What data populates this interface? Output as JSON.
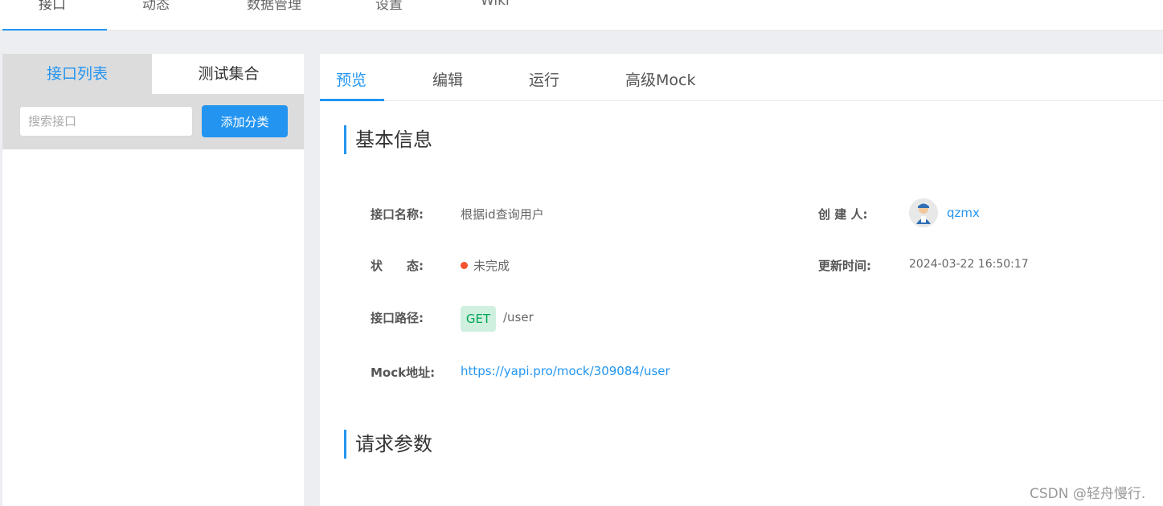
{
  "topnav": {
    "tabs": [
      "接口",
      "动态",
      "数据管理",
      "设置",
      "Wiki"
    ]
  },
  "sidebar": {
    "tabs": [
      "接口列表",
      "测试集合"
    ],
    "search_placeholder": "搜索接口",
    "add_category_label": "添加分类"
  },
  "main": {
    "tabs": [
      "预览",
      "编辑",
      "运行",
      "高级Mock"
    ],
    "section_basic": "基本信息",
    "section_request": "请求参数",
    "fields": {
      "name_label": "接口名称:",
      "name_value": "根据id查询用户",
      "creator_label": "创 建 人:",
      "creator_value": "qzmx",
      "status_label": "状　　态:",
      "status_value": "未完成",
      "updated_label": "更新时间:",
      "updated_value": "2024-03-22 16:50:17",
      "path_label": "接口路径:",
      "method": "GET",
      "path_value": "/user",
      "mock_label": "Mock地址:",
      "mock_value": "https://yapi.pro/mock/309084/user"
    }
  },
  "watermark": "CSDN @轻舟慢行.",
  "colors": {
    "accent": "#2395f1",
    "status_incomplete": "#f5522d",
    "get_badge_bg": "#cfefdf",
    "get_badge_text": "#00a854"
  }
}
